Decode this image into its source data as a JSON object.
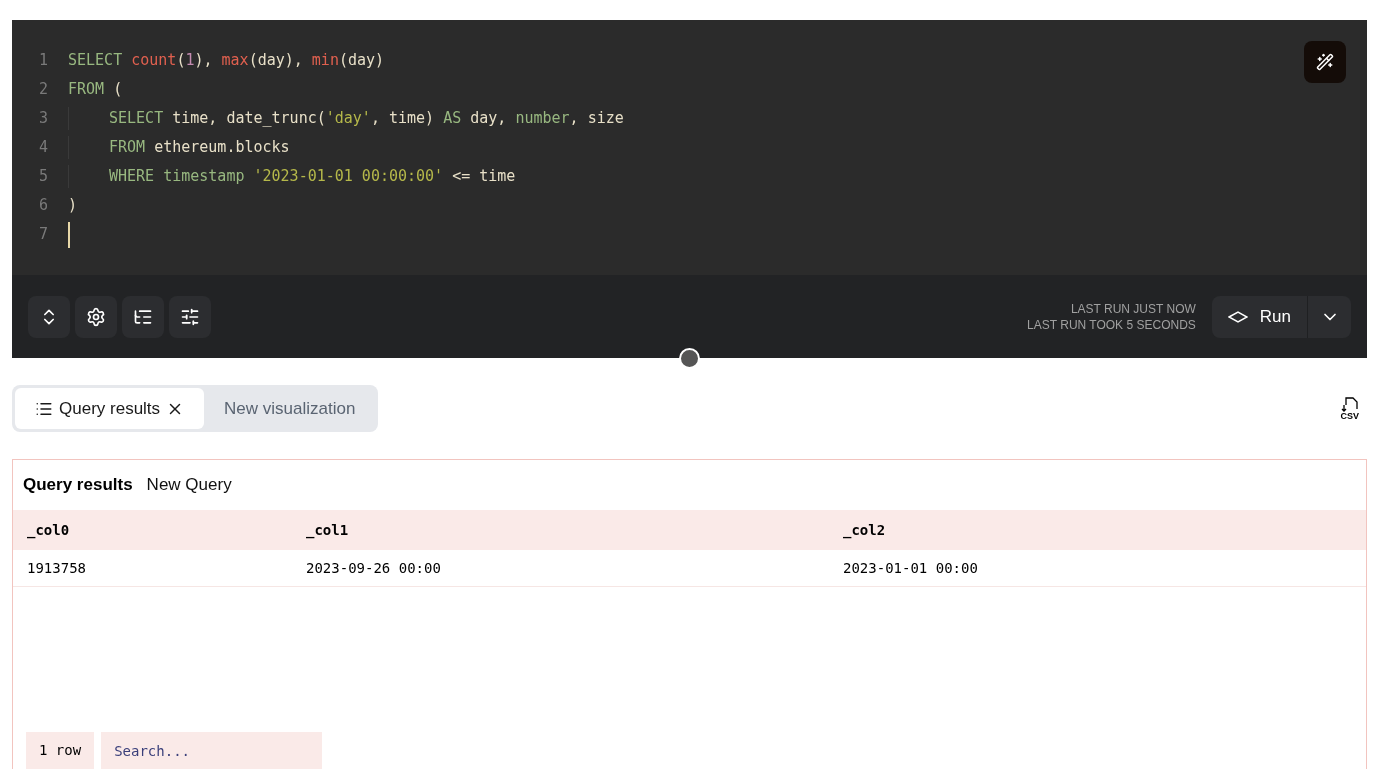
{
  "editor": {
    "lines": [
      {
        "number": "1",
        "indent": false,
        "tokens": [
          {
            "kind": "keyword",
            "text": "SELECT "
          },
          {
            "kind": "function",
            "text": "count"
          },
          {
            "kind": "plain",
            "text": "("
          },
          {
            "kind": "number",
            "text": "1"
          },
          {
            "kind": "plain",
            "text": "), "
          },
          {
            "kind": "function",
            "text": "max"
          },
          {
            "kind": "plain",
            "text": "(day), "
          },
          {
            "kind": "function",
            "text": "min"
          },
          {
            "kind": "plain",
            "text": "(day)"
          }
        ]
      },
      {
        "number": "2",
        "indent": false,
        "tokens": [
          {
            "kind": "keyword",
            "text": "FROM "
          },
          {
            "kind": "plain",
            "text": "("
          }
        ]
      },
      {
        "number": "3",
        "indent": true,
        "tokens": [
          {
            "kind": "keyword",
            "text": "SELECT "
          },
          {
            "kind": "plain",
            "text": "time, date_trunc("
          },
          {
            "kind": "string",
            "text": "'day'"
          },
          {
            "kind": "plain",
            "text": ", time) "
          },
          {
            "kind": "keyword",
            "text": "AS "
          },
          {
            "kind": "plain",
            "text": "day, "
          },
          {
            "kind": "keyword",
            "text": "number"
          },
          {
            "kind": "plain",
            "text": ", size"
          }
        ]
      },
      {
        "number": "4",
        "indent": true,
        "tokens": [
          {
            "kind": "keyword",
            "text": "FROM "
          },
          {
            "kind": "plain",
            "text": "ethereum.blocks"
          }
        ]
      },
      {
        "number": "5",
        "indent": true,
        "tokens": [
          {
            "kind": "keyword",
            "text": "WHERE "
          },
          {
            "kind": "keyword",
            "text": "timestamp "
          },
          {
            "kind": "string",
            "text": "'2023-01-01 00:00:00'"
          },
          {
            "kind": "plain",
            "text": " <= time"
          }
        ]
      },
      {
        "number": "6",
        "indent": false,
        "tokens": [
          {
            "kind": "plain",
            "text": ")"
          }
        ]
      },
      {
        "number": "7",
        "cursor": true
      }
    ]
  },
  "toolbar": {
    "last_run": "LAST RUN JUST NOW",
    "duration": "LAST RUN TOOK 5 SECONDS",
    "run_button": "Run"
  },
  "csv_label": "CSV",
  "tabs": [
    {
      "label": "Query results",
      "selected": true,
      "closable": true
    },
    {
      "label": "New visualization",
      "selected": false,
      "closable": false
    }
  ],
  "results": {
    "title": "Query results",
    "subtitle": "New Query",
    "columns": [
      "_col0",
      "_col1",
      "_col2"
    ],
    "rows": [
      [
        "1913758",
        "2023-09-26 00:00",
        "2023-01-01 00:00"
      ]
    ],
    "row_count": "1 row",
    "search": {
      "placeholder": "Search..."
    }
  }
}
